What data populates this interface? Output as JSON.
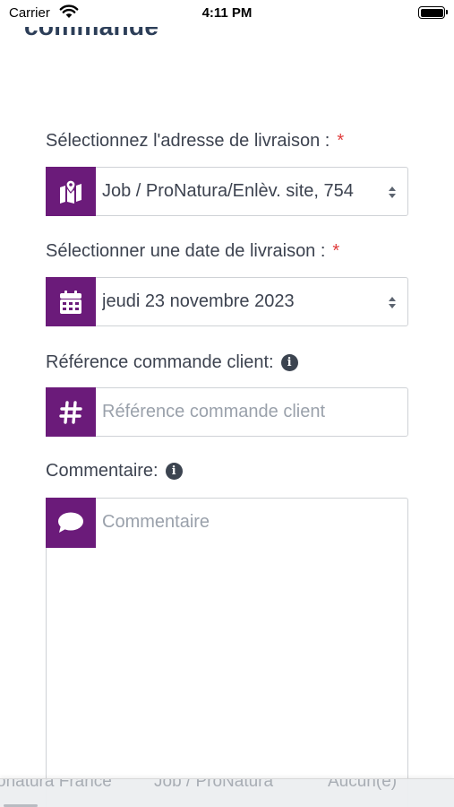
{
  "status_bar": {
    "carrier": "Carrier",
    "time": "4:11 PM"
  },
  "header": {
    "title": "commande"
  },
  "form": {
    "address": {
      "label": "Sélectionnez l'adresse de livraison :",
      "required_mark": "*",
      "value": "Job / ProNatura/Enlèv. site, 754",
      "icon": "map-icon"
    },
    "date": {
      "label": "Sélectionner une date de livraison :",
      "required_mark": "*",
      "value": "jeudi 23 novembre 2023",
      "icon": "calendar-icon"
    },
    "reference": {
      "label": "Référence commande client:",
      "placeholder": "Référence commande client",
      "icon": "hashtag-icon"
    },
    "comment": {
      "label": "Commentaire:",
      "placeholder": "Commentaire",
      "icon": "comment-icon"
    }
  },
  "bottom_bar": {
    "items": [
      "onatura France",
      "Job / ProNatura",
      "Aucun(e)"
    ]
  },
  "colors": {
    "accent": "#6b1b7a",
    "required": "#e03c3c",
    "title": "#2c3e58"
  }
}
